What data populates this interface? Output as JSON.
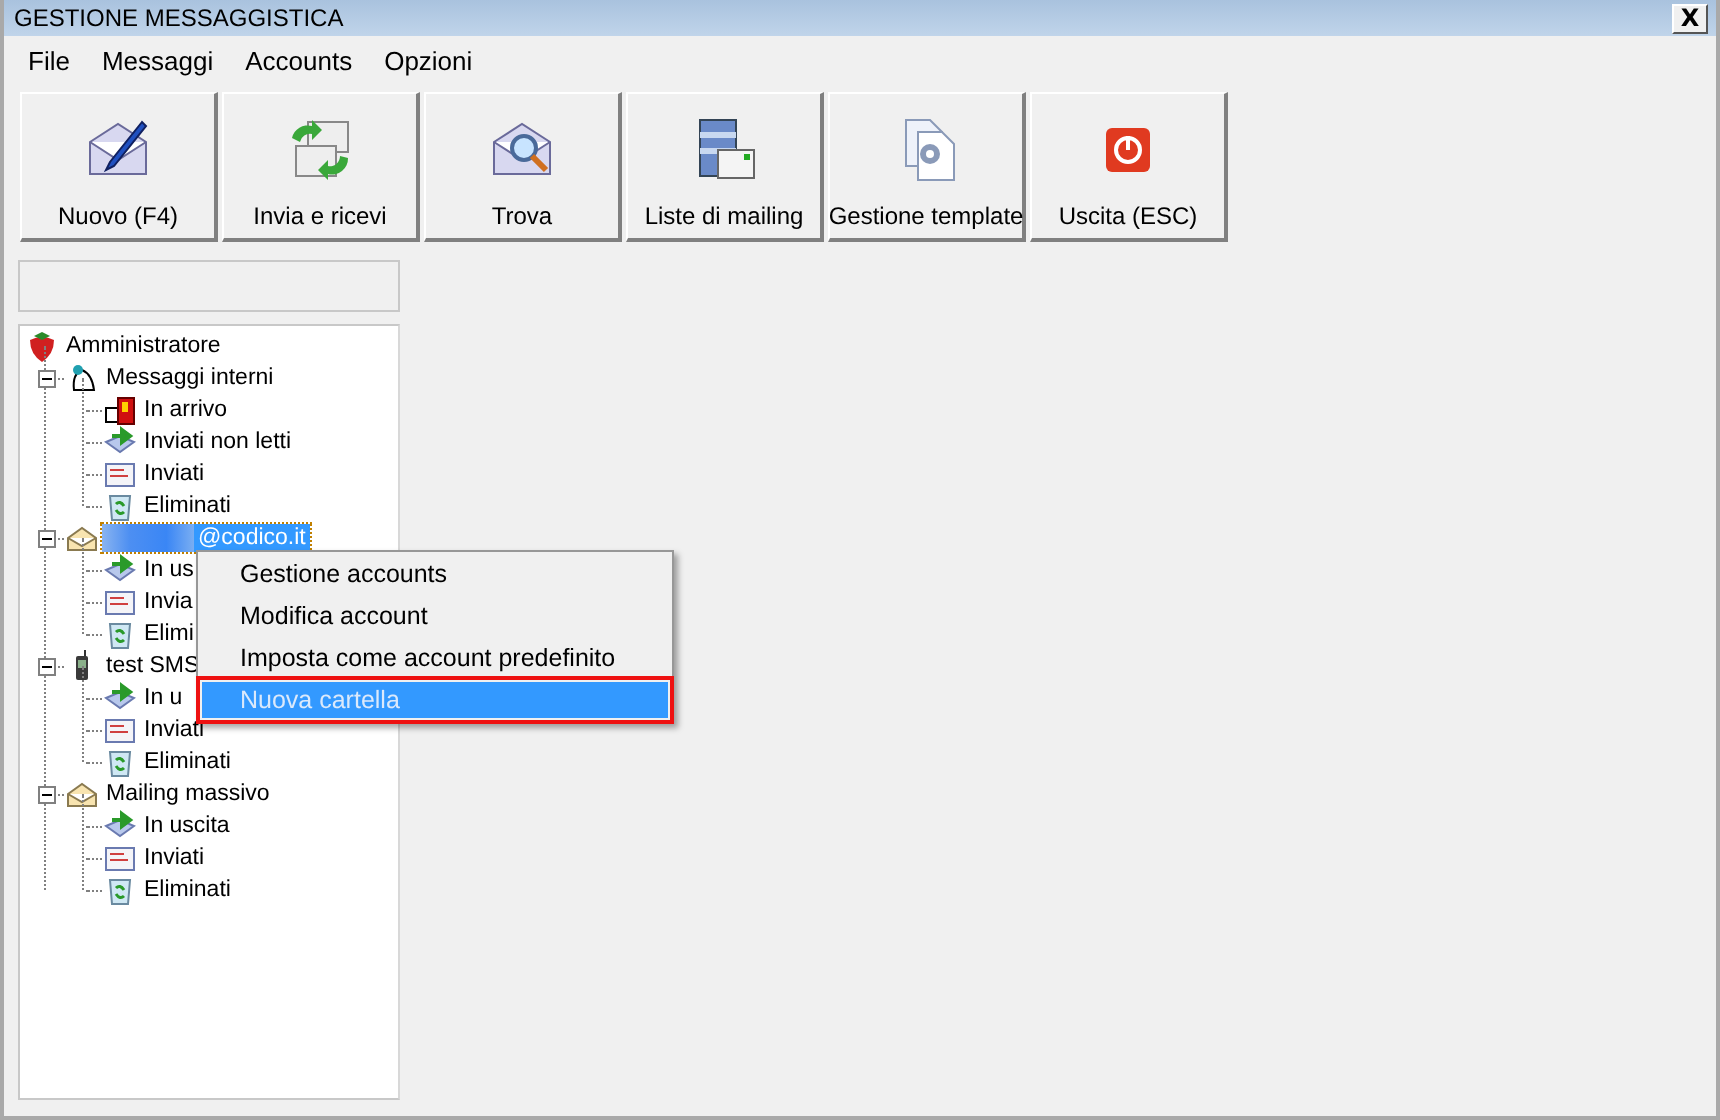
{
  "window": {
    "title": "GESTIONE MESSAGGISTICA",
    "close": "X"
  },
  "menu": [
    "File",
    "Messaggi",
    "Accounts",
    "Opzioni"
  ],
  "toolbar": [
    {
      "kind": "new",
      "label": "Nuovo (F4)"
    },
    {
      "kind": "sendreceive",
      "label": "Invia e ricevi"
    },
    {
      "kind": "find",
      "label": "Trova"
    },
    {
      "kind": "lists",
      "label": "Liste di mailing"
    },
    {
      "kind": "template",
      "label": "Gestione template"
    },
    {
      "kind": "exit",
      "label": "Uscita (ESC)"
    }
  ],
  "tree": {
    "label": "Amministratore",
    "kind": "root",
    "selected": false,
    "children": [
      {
        "label": "Messaggi interni",
        "kind": "internal",
        "expanded": true,
        "selected": false,
        "children": [
          {
            "label": "In arrivo",
            "kind": "inbox",
            "selected": false
          },
          {
            "label": "Inviati non letti",
            "kind": "outbox",
            "selected": false
          },
          {
            "label": "Inviati",
            "kind": "sent",
            "selected": false
          },
          {
            "label": "Eliminati",
            "kind": "trash",
            "selected": false
          }
        ]
      },
      {
        "label": "@codico.it",
        "kind": "account",
        "redacted": true,
        "expanded": true,
        "selected": true,
        "children": [
          {
            "label": "In us",
            "kind": "outbox",
            "selected": false
          },
          {
            "label": "Invia",
            "kind": "sent",
            "selected": false
          },
          {
            "label": "Elimi",
            "kind": "trash",
            "selected": false
          }
        ]
      },
      {
        "label": "test SMS",
        "kind": "phone",
        "expanded": true,
        "selected": false,
        "children": [
          {
            "label": "In u",
            "kind": "outbox",
            "selected": false
          },
          {
            "label": "Inviati",
            "kind": "sent",
            "selected": false
          },
          {
            "label": "Eliminati",
            "kind": "trash",
            "selected": false
          }
        ]
      },
      {
        "label": "Mailing massivo",
        "kind": "account",
        "expanded": true,
        "selected": false,
        "children": [
          {
            "label": "In uscita",
            "kind": "outbox",
            "selected": false
          },
          {
            "label": "Inviati",
            "kind": "sent",
            "selected": false
          },
          {
            "label": "Eliminati",
            "kind": "trash",
            "selected": false
          }
        ]
      }
    ]
  },
  "context_menu": [
    {
      "label": "Gestione accounts",
      "selected": false,
      "highlighted_frame": false
    },
    {
      "label": "Modifica account",
      "selected": false,
      "highlighted_frame": false
    },
    {
      "label": "Imposta come account predefinito",
      "selected": false,
      "highlighted_frame": false
    },
    {
      "label": "Nuova cartella",
      "selected": true,
      "highlighted_frame": true
    }
  ]
}
